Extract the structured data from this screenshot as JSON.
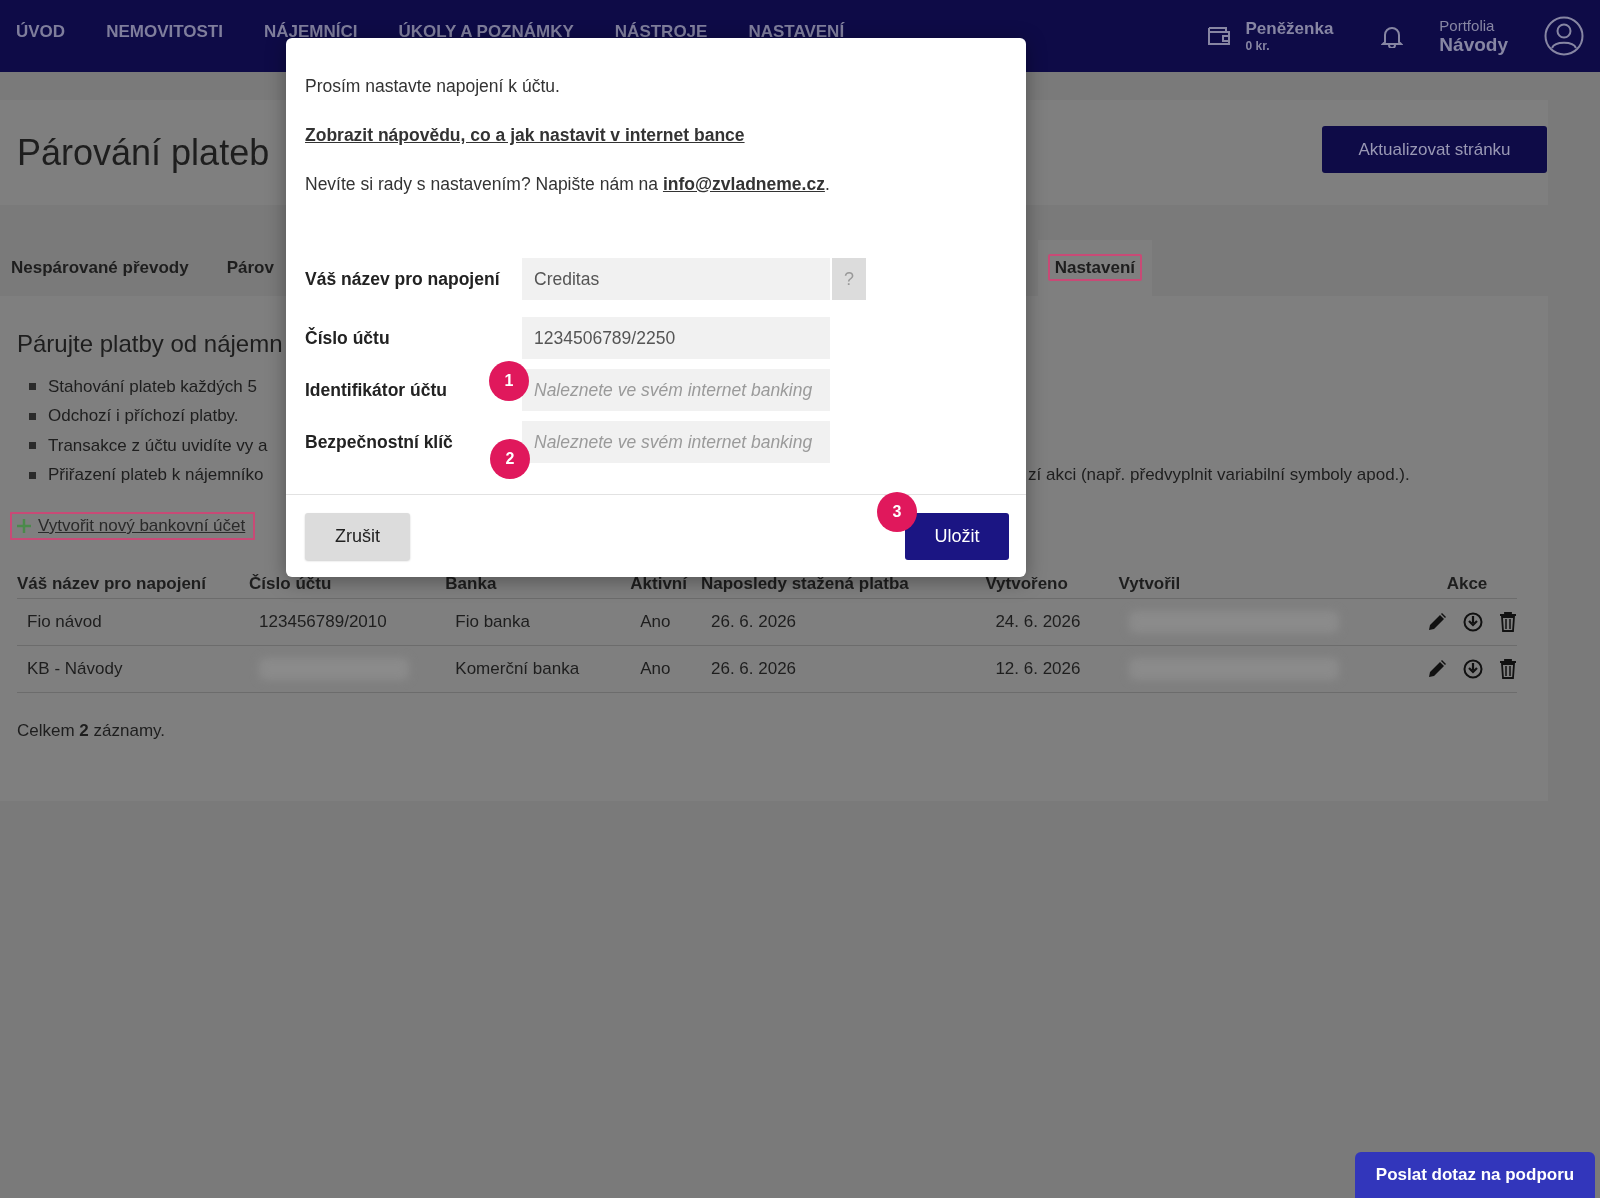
{
  "nav": {
    "items": [
      {
        "label": "ÚVOD"
      },
      {
        "label": "NEMOVITOSTI"
      },
      {
        "label": "NÁJEMNÍCI"
      },
      {
        "label": "ÚKOLY A POZNÁMKY"
      },
      {
        "label": "NÁSTROJE"
      },
      {
        "label": "NASTAVENÍ"
      }
    ],
    "wallet": {
      "label": "Peněženka",
      "amount": "0 kr."
    },
    "portfolio": {
      "label": "Portfolia",
      "value": "Návody"
    }
  },
  "page": {
    "title": "Párování plateb",
    "refresh_button": "Aktualizovat stránku"
  },
  "tabs": [
    {
      "label": "Nespárované převody",
      "selected": false,
      "highlighted": false
    },
    {
      "label": "Párov",
      "selected": false,
      "highlighted": false
    },
    {
      "label": "Nastavení",
      "selected": true,
      "highlighted": true
    }
  ],
  "panel": {
    "heading": "Párujte platby od nájemn",
    "bullets": [
      {
        "left": "Stahování plateb každých 5"
      },
      {
        "left": "Odchozí i příchozí platby."
      },
      {
        "left": "Transakce z účtu uvidíte vy a"
      },
      {
        "left": "Přiřazení plateb k nájemníko",
        "right": "zí akci (např. předvyplnit variabilní symboly apod.)."
      }
    ],
    "create_link": {
      "label": "Vytvořit nový bankovní účet",
      "highlighted": true
    }
  },
  "table": {
    "columns": [
      "Váš název pro napojení",
      "Číslo účtu",
      "Banka",
      "Aktivní",
      "Naposledy stažená platba",
      "Vytvořeno",
      "Vytvořil",
      "Akce"
    ],
    "rows": [
      {
        "cells": [
          {
            "kind": "text",
            "text": "Fio návod"
          },
          {
            "kind": "text",
            "text": "123456789/2010"
          },
          {
            "kind": "text",
            "text": "Fio banka"
          },
          {
            "kind": "text",
            "text": "Ano"
          },
          {
            "kind": "text",
            "text": "26. 6. 2026"
          },
          {
            "kind": "text",
            "text": "24. 6. 2026"
          },
          {
            "kind": "redacted"
          }
        ]
      },
      {
        "cells": [
          {
            "kind": "text",
            "text": "KB - Návody"
          },
          {
            "kind": "redacted"
          },
          {
            "kind": "text",
            "text": "Komerční banka"
          },
          {
            "kind": "text",
            "text": "Ano"
          },
          {
            "kind": "text",
            "text": "26. 6. 2026"
          },
          {
            "kind": "text",
            "text": "12. 6. 2026"
          },
          {
            "kind": "redacted"
          }
        ]
      }
    ],
    "summary": "Celkem **2** záznamy."
  },
  "dialog": {
    "intro": "Prosím nastavte napojení k účtu.",
    "help_link": "Zobrazit nápovědu, co a jak nastavit v internet bance",
    "contact_text": "Nevíte si rady s nastavením? Napište nám na",
    "contact_email": "info@zvladneme.cz",
    "contact_end": ".",
    "fields": [
      {
        "label": "Váš název pro napojení",
        "value": "Creditas",
        "help": "?"
      },
      {
        "label": "Číslo účtu",
        "value": "1234506789/2250"
      },
      {
        "label": "Identifikátor účtu",
        "placeholder": "Naleznete ve svém internet banking"
      },
      {
        "label": "Bezpečnostní klíč",
        "placeholder": "Naleznete ve svém internet banking"
      }
    ],
    "cancel": "Zrušit",
    "save": "Uložit",
    "markers": [
      {
        "label": "1"
      },
      {
        "label": "2"
      },
      {
        "label": "3"
      }
    ]
  },
  "support_button": "Poslat dotaz na podporu"
}
